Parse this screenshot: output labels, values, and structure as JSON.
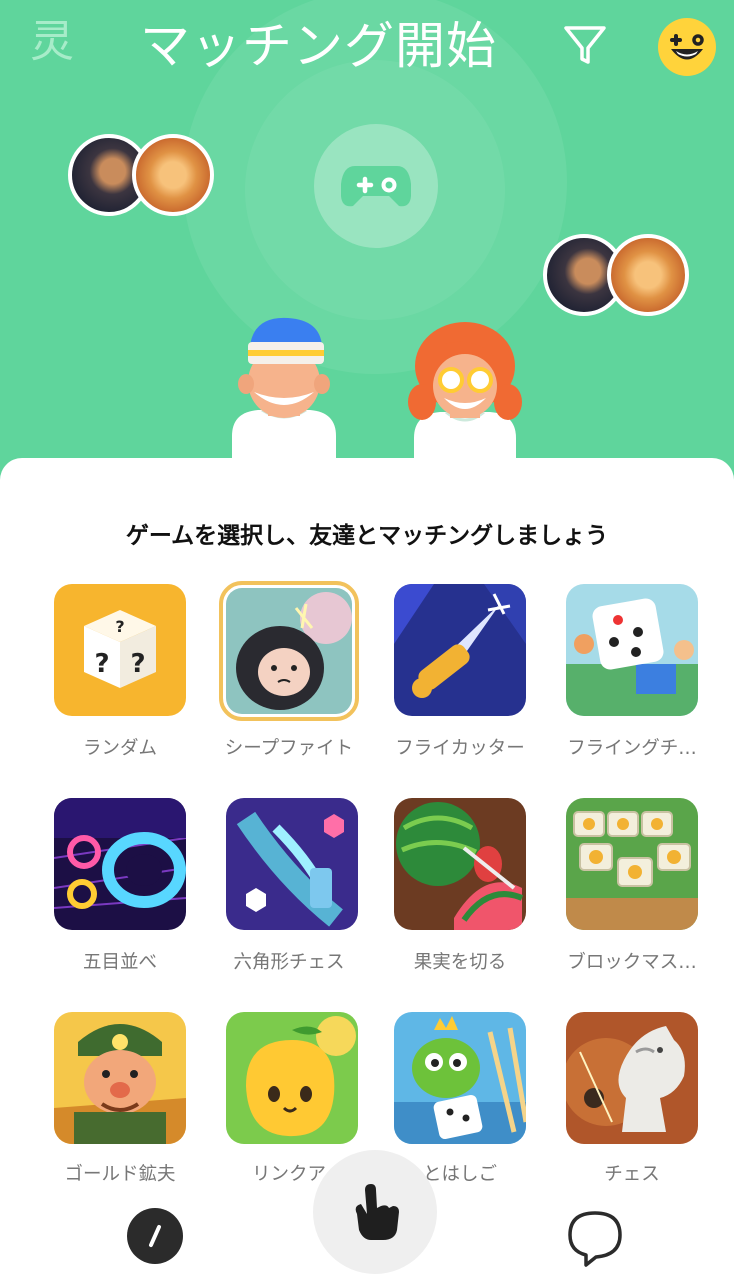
{
  "header": {
    "logo_text": "灵",
    "title": "マッチング開始"
  },
  "sheet": {
    "subtitle": "ゲームを選択し、友達とマッチングしましょう"
  },
  "games": [
    {
      "label": "ランダム",
      "selected": false
    },
    {
      "label": "シープファイト",
      "selected": true
    },
    {
      "label": "フライカッター",
      "selected": false
    },
    {
      "label": "フライングチ…",
      "selected": false
    },
    {
      "label": "五目並べ",
      "selected": false
    },
    {
      "label": "六角形チェス",
      "selected": false
    },
    {
      "label": "果実を切る",
      "selected": false
    },
    {
      "label": "ブロックマス…",
      "selected": false
    },
    {
      "label": "ゴールド鉱夫",
      "selected": false
    },
    {
      "label": "リンクア",
      "selected": false
    },
    {
      "label": "とはしご",
      "selected": false
    },
    {
      "label": "チェス",
      "selected": false
    }
  ],
  "icons": {
    "filter": "filter-icon",
    "smiley": "smiley-icon",
    "controller": "gamepad-icon",
    "nav_left": "compass-icon",
    "nav_center": "hand-gesture-icon",
    "nav_right": "chat-bubble-icon"
  },
  "colors": {
    "header_bg": "#5fd59c",
    "selected_border": "#f2c25c"
  }
}
